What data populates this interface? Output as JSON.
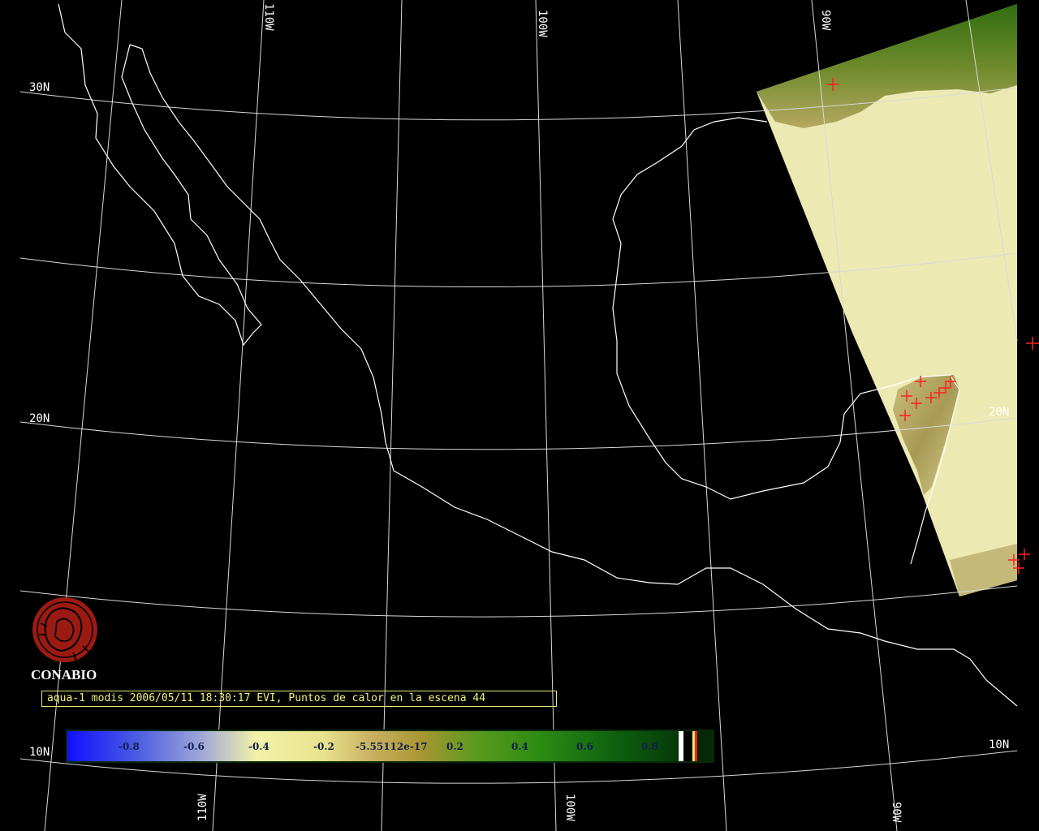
{
  "map": {
    "background": "#000000",
    "scene_fill": "#ece9b2",
    "grid_color": "#d8d8d8",
    "coast_color": "#ffffff",
    "hotspot_color": "#ff2020"
  },
  "grid_labels": {
    "lat_30n_left": "30N",
    "lat_20n_left": "20N",
    "lat_10n_left": "10N",
    "lat_20n_right": "20N",
    "lat_10n_right": "10N",
    "lon_110w_top": "110W",
    "lon_100w_top": "100W",
    "lon_90w_top": "90W",
    "lon_110w_bottom": "110W",
    "lon_100w_bottom": "100W",
    "lon_90w_bottom": "90W"
  },
  "logo": {
    "name": "CONABIO",
    "color": "#9b1b13"
  },
  "caption": "aqua-1 modis 2006/05/11 18:30:17 EVI, Puntos de calor en la escena 44",
  "colorbar": {
    "ticks": [
      "-0.8",
      "-0.6",
      "-0.4",
      "-0.2",
      "-5.55112e-17",
      "0.2",
      "0.4",
      "0.6",
      "0.8"
    ]
  }
}
